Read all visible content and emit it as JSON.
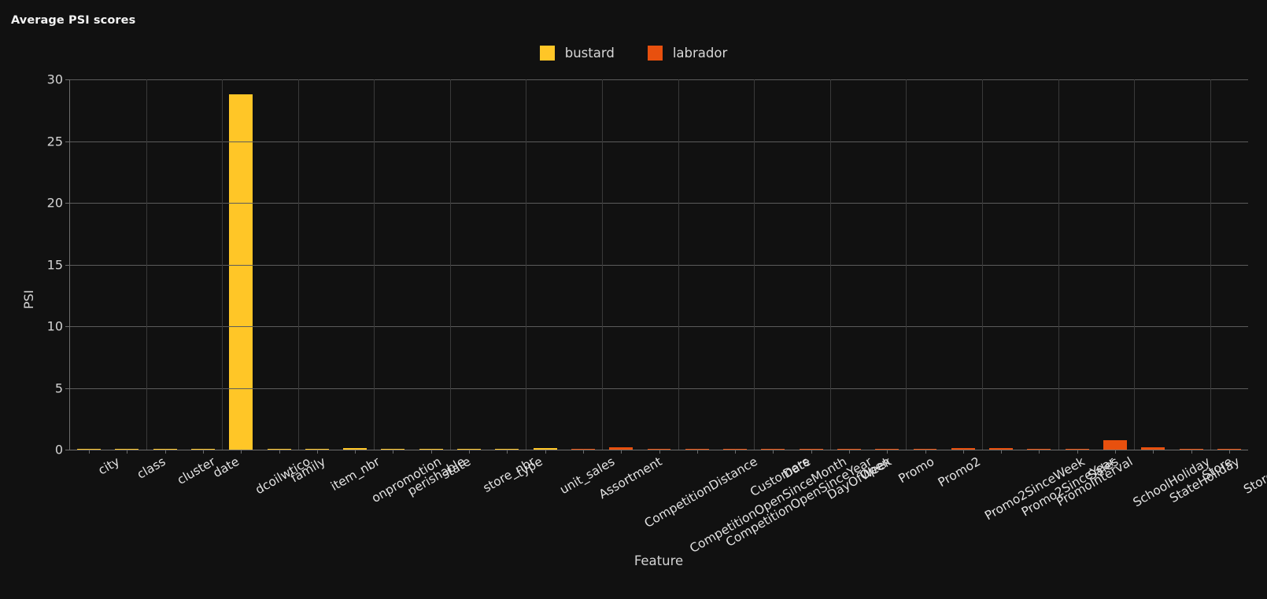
{
  "chart_data": {
    "type": "bar",
    "title": "Average PSI scores",
    "xlabel": "Feature",
    "ylabel": "PSI",
    "ylim": [
      0,
      30
    ],
    "yticks": [
      0,
      5,
      10,
      15,
      20,
      25,
      30
    ],
    "grid": true,
    "legend_position": "top-center",
    "legend": [
      {
        "name": "bustard",
        "color": "#ffc627"
      },
      {
        "name": "labrador",
        "color": "#e8500e"
      }
    ],
    "categories": [
      "city",
      "class",
      "cluster",
      "date",
      "dcoilwtico",
      "family",
      "item_nbr",
      "onpromotion",
      "perishable",
      "state",
      "store_nbr",
      "type",
      "unit_sales",
      "Assortment",
      "CompetitionDistance",
      "CompetitionOpenSinceMonth",
      "CompetitionOpenSinceYear",
      "Customers",
      "Date",
      "DayOfWeek",
      "Open",
      "Promo",
      "Promo2",
      "Promo2SinceWeek",
      "Promo2SinceYear",
      "PromoInterval",
      "Sales",
      "SchoolHoliday",
      "StateHoliday",
      "Store",
      "StoreType"
    ],
    "series": [
      {
        "name": "bustard",
        "color": "#ffc627",
        "values": [
          0.01,
          0.01,
          0.02,
          0.02,
          28.8,
          0.02,
          0.02,
          0.12,
          0.01,
          0.01,
          0.02,
          0.02,
          0.13,
          null,
          null,
          null,
          null,
          null,
          null,
          null,
          null,
          null,
          null,
          null,
          null,
          null,
          null,
          null,
          null,
          null,
          null
        ]
      },
      {
        "name": "labrador",
        "color": "#e8500e",
        "values": [
          null,
          null,
          null,
          null,
          null,
          null,
          null,
          null,
          null,
          null,
          null,
          null,
          null,
          0.06,
          0.22,
          0.05,
          0.05,
          0.05,
          0.04,
          0.03,
          0.03,
          0.05,
          0.04,
          0.14,
          0.1,
          0.03,
          0.05,
          0.75,
          0.2,
          0.05,
          0.04
        ]
      }
    ]
  }
}
